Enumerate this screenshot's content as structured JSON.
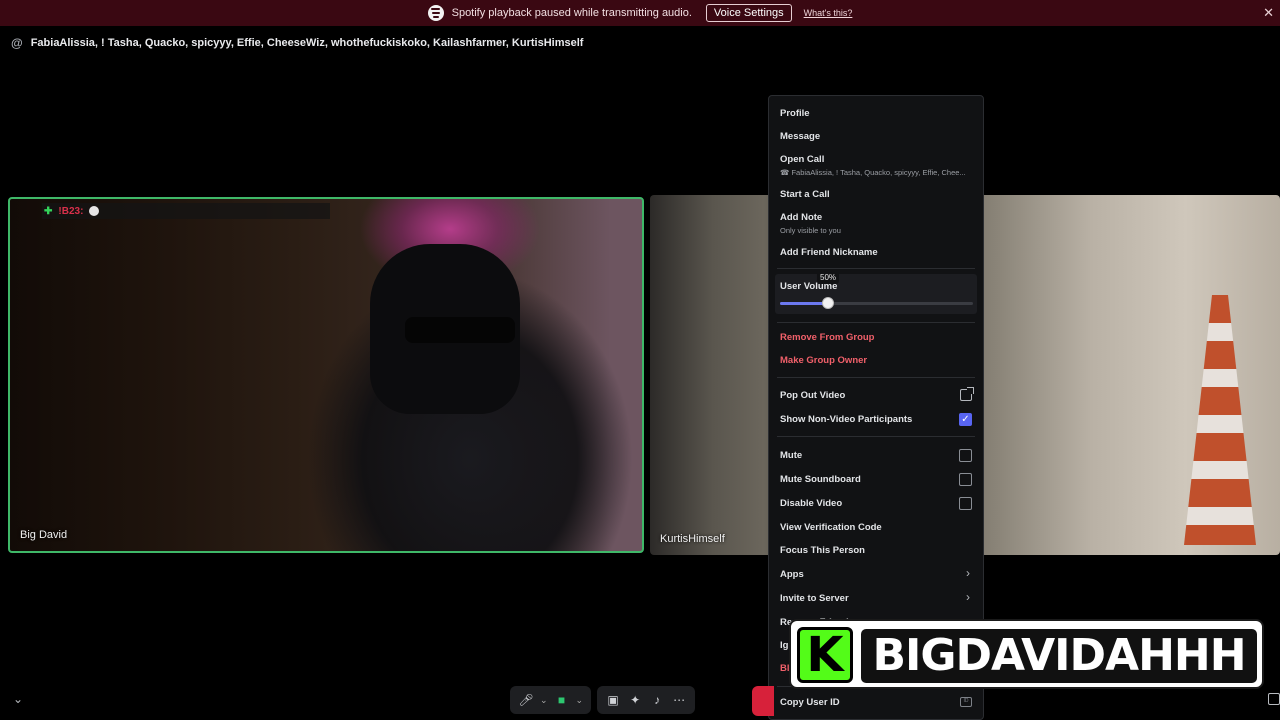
{
  "notice": {
    "message": "Spotify playback paused while transmitting audio.",
    "voice_settings_label": "Voice Settings",
    "whats_this_label": "What's this?",
    "close_glyph": "✕",
    "spotify_icon": "spotify-icon"
  },
  "header": {
    "at_glyph": "@",
    "title": "FabiaAlissia, ! Tasha, Quacko, spicyyy, Effie, CheeseWiz, whothefuckiskoko, Kailashfarmer, KurtisHimself"
  },
  "tiles": [
    {
      "label": "Big David",
      "overlay_tag": "!B23:",
      "overlay_plus": "✚",
      "border_color": "#3fb868"
    },
    {
      "label": "KurtisHimself"
    }
  ],
  "menu": {
    "profile": "Profile",
    "message": "Message",
    "open_call": "Open Call",
    "open_call_sub": "FabiaAlissia, ! Tasha, Quacko, spicyyy, Effie, Chee...",
    "start_call": "Start a Call",
    "add_note": "Add Note",
    "add_note_sub": "Only visible to you",
    "add_friend_nickname": "Add Friend Nickname",
    "user_volume": "User Volume",
    "volume_value": 0.25,
    "volume_tooltip": "50%",
    "remove_from_group": "Remove From Group",
    "make_group_owner": "Make Group Owner",
    "pop_out_video": "Pop Out Video",
    "show_non_video": "Show Non-Video Participants",
    "show_non_video_checked": true,
    "mute": "Mute",
    "mute_soundboard": "Mute Soundboard",
    "disable_video": "Disable Video",
    "view_verification_code": "View Verification Code",
    "focus_this_person": "Focus This Person",
    "apps": "Apps",
    "invite_to_server": "Invite to Server",
    "remove_friend": "Remove Friend",
    "ignore": "Ig",
    "block": "Bl",
    "copy_user_id": "Copy User ID",
    "id_badge": "ID"
  },
  "controls": {
    "mic_icon": "microphone-icon",
    "camera_icon": "camera-icon",
    "screen_share_icon": "screen-share-icon",
    "activities_icon": "activities-icon",
    "soundboard_icon": "soundboard-icon",
    "more_icon": "more-icon",
    "chevron": "⌄"
  },
  "overlay": {
    "badge_letter": "K",
    "text": "BIGDAVIDAHHH",
    "badge_color": "#53fc18"
  },
  "colors": {
    "notice_bg": "#3a0812",
    "accent": "#5865f2",
    "danger": "#f0606a",
    "speaking_border": "#3fb868"
  }
}
